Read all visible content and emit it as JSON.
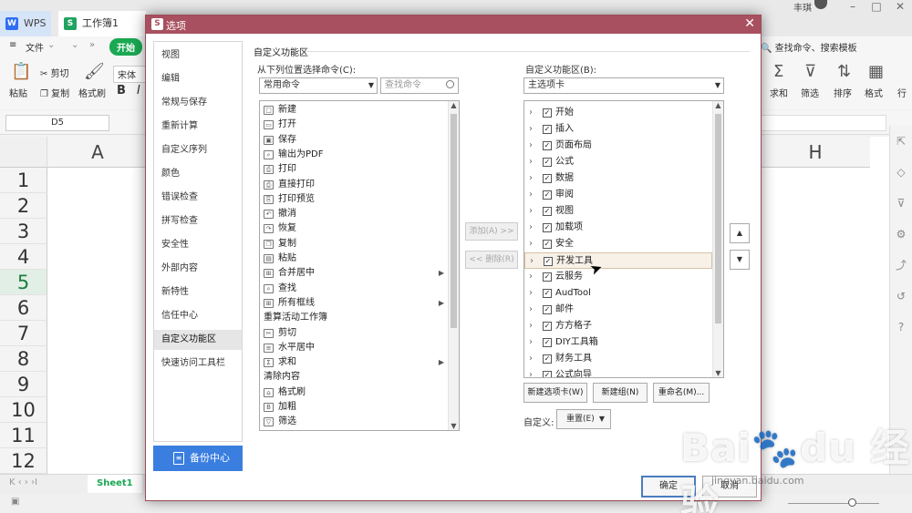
{
  "app": {
    "tabs": [
      {
        "label": "WPS",
        "icon": "wps-logo-icon"
      },
      {
        "label": "工作簿1",
        "icon": "spreadsheet-icon"
      }
    ],
    "user_name": "丰琪",
    "window_controls": [
      "minimize",
      "restore",
      "close"
    ]
  },
  "menubar": {
    "menu_label": "文件",
    "start_label": "开始",
    "search_label": "查找命令、搜索模板"
  },
  "ribbon": {
    "paste": "粘贴",
    "cut": "剪切",
    "copy": "复制",
    "format_painter": "格式刷",
    "font": "宋体",
    "bold": "B",
    "italic": "I",
    "sum": "求和",
    "filter": "筛选",
    "sort": "排序",
    "format": "格式",
    "row": "行"
  },
  "formula_bar": {
    "name_box": "D5"
  },
  "sheet": {
    "columns": [
      "A",
      "H"
    ],
    "rows": [
      "1",
      "2",
      "3",
      "4",
      "5",
      "6",
      "7",
      "8",
      "9",
      "10",
      "11",
      "12"
    ],
    "active_row": "5",
    "sheet_tab": "Sheet1"
  },
  "dialog": {
    "title": "选项",
    "nav_items": [
      "视图",
      "编辑",
      "常规与保存",
      "重新计算",
      "自定义序列",
      "颜色",
      "错误检查",
      "拼写检查",
      "安全性",
      "外部内容",
      "新特性",
      "信任中心",
      "自定义功能区",
      "快速访问工具栏"
    ],
    "active_nav": "自定义功能区",
    "backup_label": "备份中心",
    "section_title": "自定义功能区",
    "choose_from_label": "从下列位置选择命令(C):",
    "customize_label": "自定义功能区(B):",
    "commands_combo": "常用命令",
    "commands_search_placeholder": "查找命令",
    "tabs_combo": "主选项卡",
    "commands": [
      {
        "label": "新建",
        "icon": "new-doc-icon"
      },
      {
        "label": "打开",
        "icon": "folder-open-icon"
      },
      {
        "label": "保存",
        "icon": "save-icon"
      },
      {
        "label": "输出为PDF",
        "icon": "pdf-icon"
      },
      {
        "label": "打印",
        "icon": "print-icon"
      },
      {
        "label": "直接打印",
        "icon": "quick-print-icon"
      },
      {
        "label": "打印预览",
        "icon": "print-preview-icon"
      },
      {
        "label": "撤消",
        "icon": "undo-icon"
      },
      {
        "label": "恢复",
        "icon": "redo-icon"
      },
      {
        "label": "复制",
        "icon": "copy-icon"
      },
      {
        "label": "粘贴",
        "icon": "paste-icon"
      },
      {
        "label": "合并居中",
        "icon": "merge-center-icon",
        "submenu": true
      },
      {
        "label": "查找",
        "icon": "find-icon"
      },
      {
        "label": "所有框线",
        "icon": "all-borders-icon",
        "submenu": true
      },
      {
        "label": "重算活动工作簿",
        "icon": "",
        "group": true
      },
      {
        "label": "剪切",
        "icon": "scissors-icon"
      },
      {
        "label": "水平居中",
        "icon": "align-center-icon"
      },
      {
        "label": "求和",
        "icon": "sum-icon",
        "submenu": true
      },
      {
        "label": "清除内容",
        "icon": "",
        "group": true
      },
      {
        "label": "格式刷",
        "icon": "format-painter-icon"
      },
      {
        "label": "加粗",
        "icon": "bold-icon"
      },
      {
        "label": "筛选",
        "icon": "filter-icon"
      }
    ],
    "add_button": "添加(A) >>",
    "remove_button": "<< 删除(R)",
    "ribbon_tabs": [
      {
        "label": "开始",
        "checked": true
      },
      {
        "label": "插入",
        "checked": true
      },
      {
        "label": "页面布局",
        "checked": true
      },
      {
        "label": "公式",
        "checked": true
      },
      {
        "label": "数据",
        "checked": true
      },
      {
        "label": "审阅",
        "checked": true
      },
      {
        "label": "视图",
        "checked": true
      },
      {
        "label": "加载项",
        "checked": true
      },
      {
        "label": "安全",
        "checked": true
      },
      {
        "label": "开发工具",
        "checked": true,
        "selected": true
      },
      {
        "label": "云服务",
        "checked": true
      },
      {
        "label": "AudTool",
        "checked": true
      },
      {
        "label": "邮件",
        "checked": true
      },
      {
        "label": "方方格子",
        "checked": true
      },
      {
        "label": "DIY工具箱",
        "checked": true
      },
      {
        "label": "财务工具",
        "checked": true
      },
      {
        "label": "公式向导",
        "checked": true
      }
    ],
    "new_tab_button": "新建选项卡(W)",
    "new_group_button": "新建组(N)",
    "rename_button": "重命名(M)...",
    "custom_label": "自定义:",
    "reset_button": "重置(E)",
    "ok_button": "确定",
    "cancel_button": "取消"
  },
  "watermark": {
    "text": "Bai du 经验",
    "url": "jingyan.baidu.com"
  },
  "colors": {
    "dialog_title": "#a8505f",
    "accent_green": "#1aa853",
    "backup_button": "#3a7ee0"
  }
}
